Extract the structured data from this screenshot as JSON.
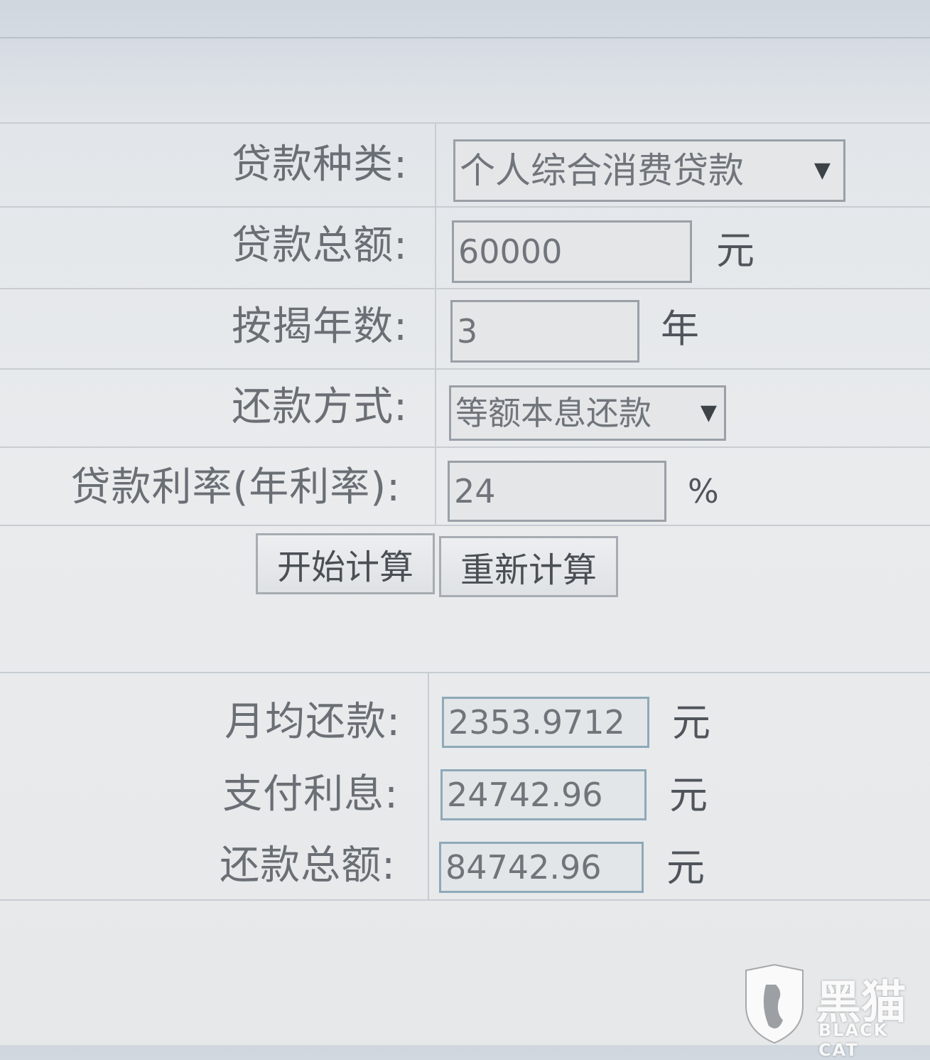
{
  "form": {
    "loan_type": {
      "label": "贷款种类:",
      "value": "个人综合消费贷款"
    },
    "loan_amount": {
      "label": "贷款总额:",
      "value": "60000",
      "unit": "元"
    },
    "years": {
      "label": "按揭年数:",
      "value": "3",
      "unit": "年"
    },
    "repay_method": {
      "label": "还款方式:",
      "value": "等额本息还款"
    },
    "rate": {
      "label": "贷款利率(年利率):",
      "value": "24",
      "unit": "%"
    }
  },
  "buttons": {
    "calculate": "开始计算",
    "reset": "重新计算"
  },
  "results": {
    "monthly": {
      "label": "月均还款:",
      "value": "2353.9712",
      "unit": "元"
    },
    "interest": {
      "label": "支付利息:",
      "value": "24742.96",
      "unit": "元"
    },
    "total": {
      "label": "还款总额:",
      "value": "84742.96",
      "unit": "元"
    }
  },
  "watermark": {
    "cn": "黑猫",
    "en": "BLACK CAT"
  },
  "icons": {
    "dropdown": "triangle-down-icon",
    "watermark_logo": "black-cat-shield-icon"
  }
}
